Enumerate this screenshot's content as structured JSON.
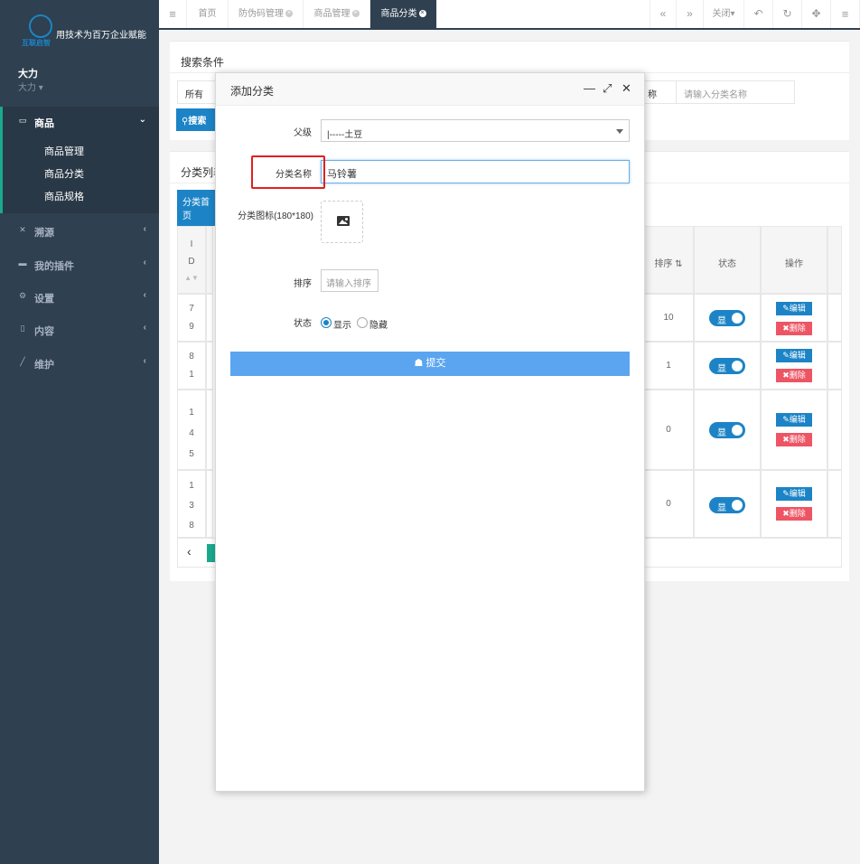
{
  "sidebar": {
    "brand": "互联启智",
    "slogan": "用技术为百万企业赋能",
    "user_name": "大力",
    "user_role": "大力",
    "menu": [
      {
        "label": "商品",
        "icon": "laptop-icon"
      },
      {
        "label": "溯源",
        "icon": "tools-icon"
      },
      {
        "label": "我的插件",
        "icon": "keyboard-icon"
      },
      {
        "label": "设置",
        "icon": "gear-icon"
      },
      {
        "label": "内容",
        "icon": "book-icon"
      },
      {
        "label": "维护",
        "icon": "wand-icon"
      }
    ],
    "submenu": [
      "商品管理",
      "商品分类",
      "商品规格"
    ]
  },
  "tabs": {
    "items": [
      "首页",
      "防伪码管理",
      "商品管理",
      "商品分类"
    ],
    "close_label": "关闭"
  },
  "search_panel": {
    "title": "搜索条件",
    "select_value": "所有",
    "field_label": "称",
    "placeholder": "请输入分类名称",
    "search_button": "搜索"
  },
  "list_panel": {
    "title": "分类列表",
    "first_button": "分类首页",
    "col_id": "I\nD",
    "col_sort": "排序",
    "col_status": "状态",
    "col_action": "操作",
    "rows": [
      {
        "id": "7\n9",
        "sort": "10",
        "status": "显"
      },
      {
        "id": "8\n1",
        "sort": "1",
        "status": "显"
      },
      {
        "id": "1\n4\n5",
        "sort": "0",
        "status": "显"
      },
      {
        "id": "1\n3\n8",
        "sort": "0",
        "status": "显"
      }
    ],
    "edit_label": "编辑",
    "delete_label": "删除"
  },
  "dialog": {
    "title": "添加分类",
    "parent_label": "父级",
    "parent_value": "|-----土豆",
    "name_label": "分类名称",
    "name_value": "马铃薯",
    "icon_label": "分类图标(180*180)",
    "sort_label": "排序",
    "sort_placeholder": "请输入排序",
    "status_label": "状态",
    "status_show": "显示",
    "status_hide": "隐藏",
    "submit_label": "提交"
  }
}
